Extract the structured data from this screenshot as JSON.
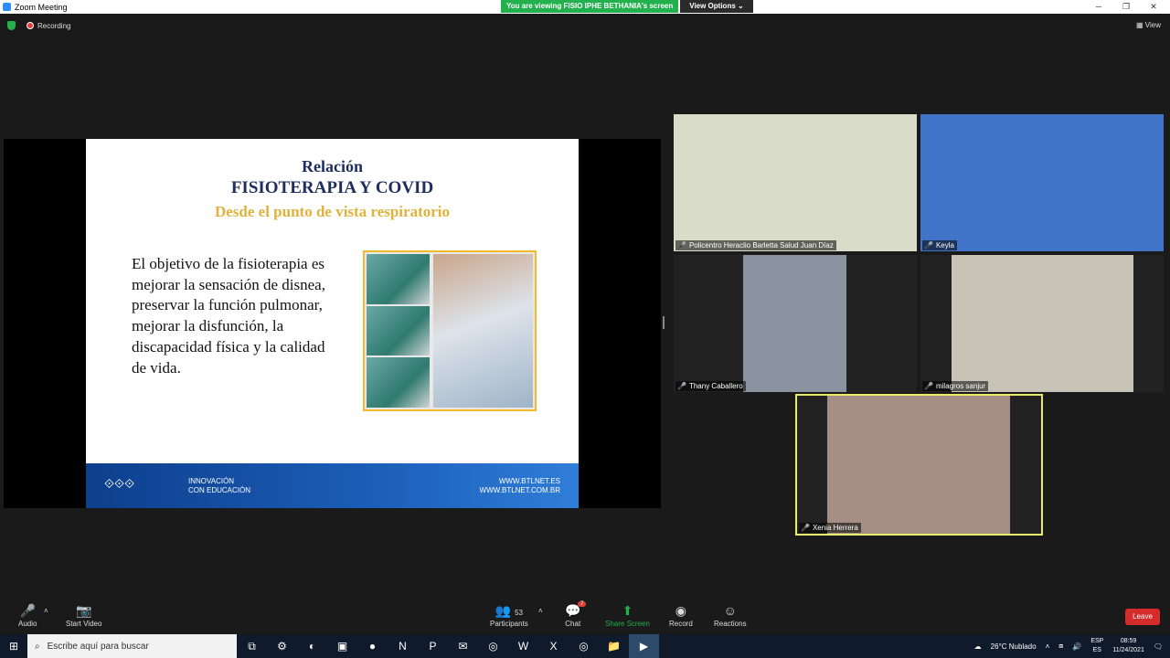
{
  "window": {
    "title": "Zoom Meeting",
    "controls": {
      "minimize": "─",
      "maximize": "❐",
      "close": "✕"
    }
  },
  "share_banner": {
    "message": "You are viewing FISIO IPHE BETHANIA's screen",
    "view_options": "View Options ⌄"
  },
  "status": {
    "recording": "Recording",
    "view": "View"
  },
  "slide": {
    "title1": "Relación",
    "title2": "FISIOTERAPIA Y COVID",
    "title3": "Desde el punto de vista respiratorio",
    "body": "El objetivo de la fisioterapia es mejorar la sensación de disnea, preservar la función pulmonar, mejorar la disfunción, la discapacidad física y la calidad de vida.",
    "footer_line1": "INNOVACIÓN",
    "footer_line2": "CON EDUCACIÓN",
    "footer_url1": "WWW.BTLNET.ES",
    "footer_url2": "WWW.BTLNET.COM.BR"
  },
  "participants": [
    {
      "name": "Policentro Heraclio Barletta Salud Juan Díaz",
      "bg": "#d8dcc8"
    },
    {
      "name": "Keyla",
      "bg": "#3f74c8"
    },
    {
      "name": "Thany Caballero",
      "bg": "#8b93a0"
    },
    {
      "name": "milagros sanjur",
      "bg": "#c7c3b7"
    },
    {
      "name": "Xenia Herrera",
      "bg": "#a58f84"
    }
  ],
  "toolbar": {
    "audio": "Audio",
    "start_video": "Start Video",
    "participants": "Participants",
    "participants_count": "53",
    "chat": "Chat",
    "chat_badge": "7",
    "share_screen": "Share Screen",
    "record": "Record",
    "reactions": "Reactions",
    "leave": "Leave"
  },
  "taskbar": {
    "search_placeholder": "Escribe aquí para buscar",
    "weather": "26°C  Nublado",
    "lang1": "ESP",
    "lang2": "ES",
    "time": "08:59",
    "date": "11/24/2021"
  }
}
